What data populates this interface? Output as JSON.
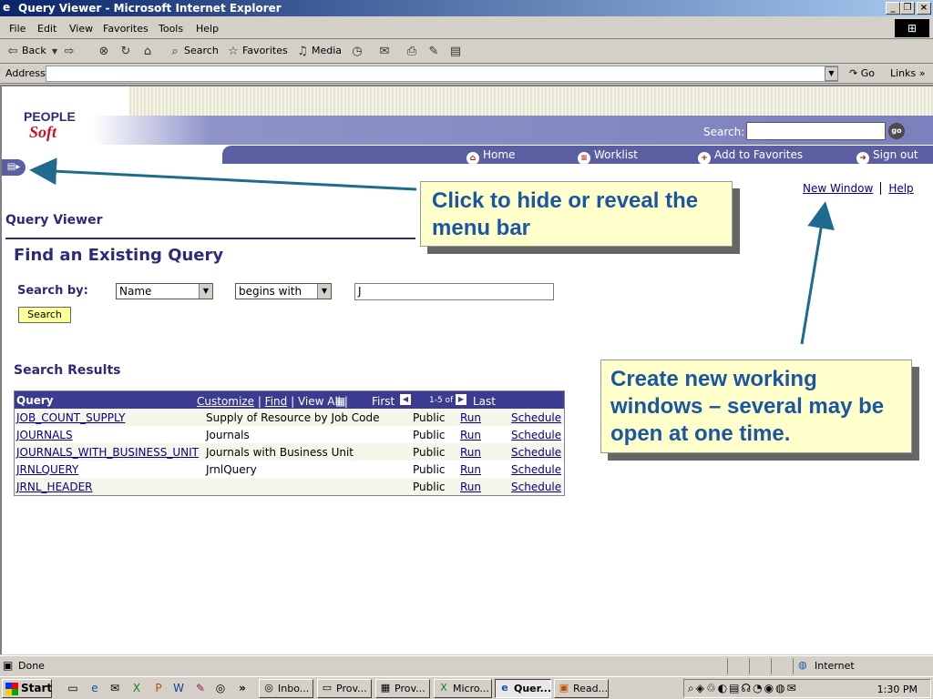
{
  "window": {
    "title": "Query Viewer - Microsoft Internet Explorer"
  },
  "menu": [
    "File",
    "Edit",
    "View",
    "Favorites",
    "Tools",
    "Help"
  ],
  "toolbar": {
    "back": "Back",
    "search": "Search",
    "favorites": "Favorites",
    "media": "Media"
  },
  "address": {
    "label": "Address",
    "value": "",
    "go": "Go",
    "links": "Links"
  },
  "ps": {
    "logo_top": "PEOPLE",
    "logo_bottom": "Soft",
    "search_label": "Search:",
    "go_label": "go",
    "nav": [
      "Home",
      "Worklist",
      "Add to Favorites",
      "Sign out"
    ],
    "new_window": "New Window",
    "help": "Help"
  },
  "page": {
    "component_title": "Query Viewer",
    "heading": "Find an Existing Query",
    "search_by_label": "Search by:",
    "search_field": "Name",
    "operator": "begins with",
    "search_value": "J",
    "search_button": "Search",
    "results_title": "Search Results"
  },
  "results": {
    "header": "Query",
    "customize": "Customize",
    "find": "Find",
    "view_all": "View All",
    "first": "First",
    "range": "1-5 of 5",
    "last": "Last",
    "rows": [
      {
        "query": "JOB_COUNT_SUPPLY",
        "desc": "Supply of Resource by Job Code",
        "owner": "Public",
        "run": "Run",
        "schedule": "Schedule"
      },
      {
        "query": "JOURNALS",
        "desc": "Journals",
        "owner": "Public",
        "run": "Run",
        "schedule": "Schedule"
      },
      {
        "query": "JOURNALS_WITH_BUSINESS_UNIT",
        "desc": "Journals with Business Unit",
        "owner": "Public",
        "run": "Run",
        "schedule": "Schedule"
      },
      {
        "query": "JRNLQUERY",
        "desc": "JrnlQuery",
        "owner": "Public",
        "run": "Run",
        "schedule": "Schedule"
      },
      {
        "query": "JRNL_HEADER",
        "desc": "",
        "owner": "Public",
        "run": "Run",
        "schedule": "Schedule"
      }
    ]
  },
  "callouts": {
    "menu_toggle": "Click to hide or reveal the menu bar",
    "new_window": "Create new working windows – several may be open at one time."
  },
  "status": {
    "text": "Done",
    "zone": "Internet"
  },
  "taskbar": {
    "start": "Start",
    "tasks": [
      "Inbo...",
      "Prov...",
      "Prov...",
      "Micro...",
      "Quer...",
      "Read..."
    ],
    "clock": "1:30 PM"
  },
  "colors": {
    "ps_banner": "#7b80be",
    "ps_nav": "#5b5fa2",
    "callout_text": "#1a56a2",
    "callout_bg": "#ffffcc",
    "header_row": "#3b3b91"
  }
}
